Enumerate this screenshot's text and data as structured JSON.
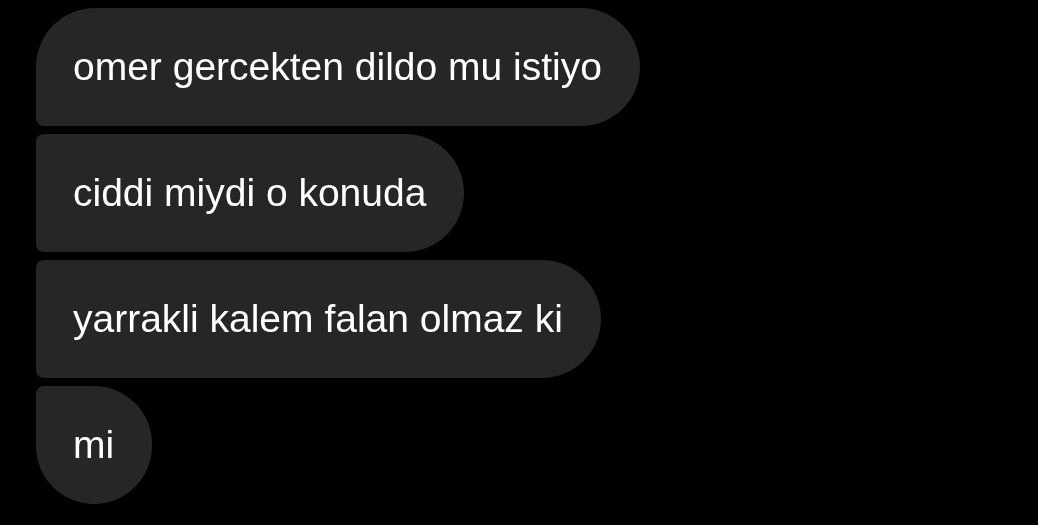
{
  "messages": [
    {
      "text": "omer gercekten dildo mu istiyo"
    },
    {
      "text": "ciddi miydi o konuda"
    },
    {
      "text": "yarrakli kalem falan olmaz ki"
    },
    {
      "text": "mi"
    }
  ]
}
